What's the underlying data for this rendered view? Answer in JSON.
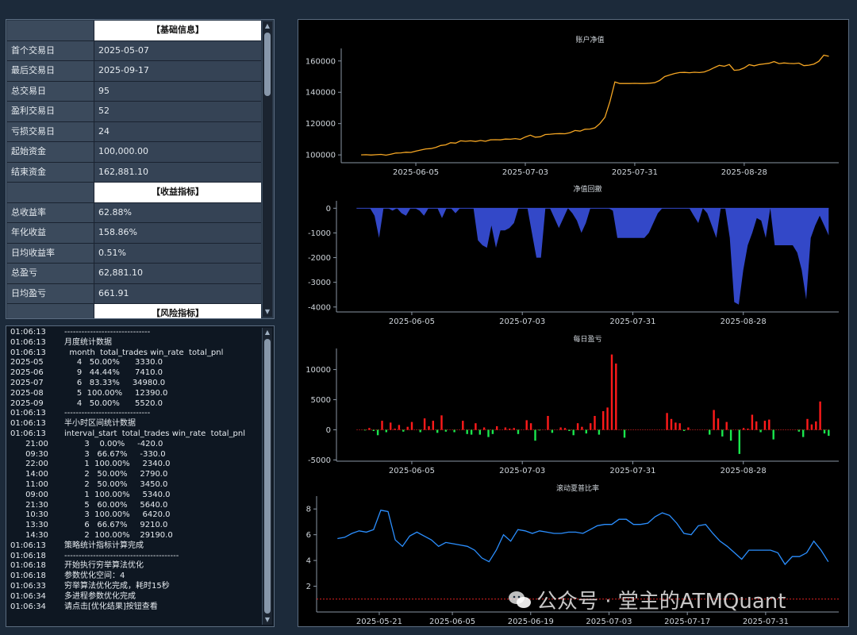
{
  "stats": {
    "rows": [
      {
        "k": "",
        "v": "【基础信息】",
        "section": true
      },
      {
        "k": "首个交易日",
        "v": "2025-05-07"
      },
      {
        "k": "最后交易日",
        "v": "2025-09-17"
      },
      {
        "k": "总交易日",
        "v": "95"
      },
      {
        "k": "盈利交易日",
        "v": "52"
      },
      {
        "k": "亏损交易日",
        "v": "24"
      },
      {
        "k": "起始资金",
        "v": "100,000.00"
      },
      {
        "k": "结束资金",
        "v": "162,881.10"
      },
      {
        "k": "",
        "v": "【收益指标】",
        "section": true
      },
      {
        "k": "总收益率",
        "v": "62.88%"
      },
      {
        "k": "年化收益",
        "v": "158.86%"
      },
      {
        "k": "日均收益率",
        "v": "0.51%"
      },
      {
        "k": "总盈亏",
        "v": "62,881.10"
      },
      {
        "k": "日均盈亏",
        "v": "661.91"
      },
      {
        "k": "",
        "v": "【风险指标】",
        "section": true
      }
    ]
  },
  "log": {
    "lines": [
      {
        "t": "01:06:13",
        "m": "------------------------------"
      },
      {
        "t": "01:06:13",
        "m": "月度统计数据"
      },
      {
        "t": "01:06:13",
        "m": "  month  total_trades win_rate  total_pnl"
      },
      {
        "t": "2025-05",
        "m": "     4   50.00%      3330.0"
      },
      {
        "t": "2025-06",
        "m": "     9   44.44%      7410.0"
      },
      {
        "t": "2025-07",
        "m": "     6   83.33%     34980.0"
      },
      {
        "t": "2025-08",
        "m": "     5  100.00%     12390.0"
      },
      {
        "t": "2025-09",
        "m": "     4   50.00%      5520.0"
      },
      {
        "t": "01:06:13",
        "m": "------------------------------"
      },
      {
        "t": "01:06:13",
        "m": "半小时区间统计数据"
      },
      {
        "t": "01:06:13",
        "m": "interval_start  total_trades win_rate  total_pnl"
      },
      {
        "t": "      21:00",
        "m": "        3    0.00%     -420.0"
      },
      {
        "t": "      09:30",
        "m": "        3   66.67%     -330.0"
      },
      {
        "t": "      22:00",
        "m": "        1  100.00%     2340.0"
      },
      {
        "t": "      14:00",
        "m": "        2   50.00%     2790.0"
      },
      {
        "t": "      11:00",
        "m": "        2   50.00%     3450.0"
      },
      {
        "t": "      09:00",
        "m": "        1  100.00%     5340.0"
      },
      {
        "t": "      21:30",
        "m": "        5   60.00%     5640.0"
      },
      {
        "t": "      10:30",
        "m": "        3  100.00%     6420.0"
      },
      {
        "t": "      13:30",
        "m": "        6   66.67%     9210.0"
      },
      {
        "t": "      14:30",
        "m": "        2  100.00%    29190.0"
      },
      {
        "t": "01:06:13",
        "m": "策略统计指标计算完成"
      },
      {
        "t": "01:06:18",
        "m": "----------------------------------------"
      },
      {
        "t": "01:06:18",
        "m": "开始执行穷举算法优化"
      },
      {
        "t": "01:06:18",
        "m": "参数优化空间：4"
      },
      {
        "t": "01:06:33",
        "m": "穷举算法优化完成，耗时15秒"
      },
      {
        "t": "01:06:34",
        "m": "多进程参数优化完成"
      },
      {
        "t": "01:06:34",
        "m": "请点击[优化结果]按钮查看"
      }
    ]
  },
  "watermark": {
    "text": "公众号 · 堂主的ATMQuant",
    "icon": "wechat-icon"
  },
  "colors": {
    "equity": "#f5a623",
    "drawdown": "#3348c8",
    "profit": "#ff1a1a",
    "loss": "#19e64d",
    "sharpe": "#2b8fff"
  },
  "chart_data": [
    {
      "type": "line",
      "title": "账户净值",
      "xticks": [
        "2025-06-05",
        "2025-07-03",
        "2025-07-31",
        "2025-08-28"
      ],
      "yticks": [
        100000,
        120000,
        140000,
        160000
      ],
      "ylim": [
        95000,
        168000
      ],
      "series": [
        {
          "values": [
            100000,
            100100,
            99900,
            100100,
            100300,
            99800,
            100500,
            101200,
            101300,
            101700,
            101600,
            102400,
            103100,
            103800,
            104000,
            104800,
            106000,
            106400,
            107800,
            107500,
            109000,
            108700,
            109000,
            108600,
            109200,
            108700,
            109600,
            109700,
            109600,
            110100,
            110000,
            110400,
            109900,
            111400,
            112600,
            111300,
            111600,
            113000,
            113200,
            113500,
            113600,
            113500,
            114200,
            115600,
            115200,
            116400,
            116500,
            117300,
            120000,
            124000,
            134000,
            146600,
            145600,
            145600,
            145600,
            145700,
            145600,
            145600,
            145800,
            146100,
            147500,
            150000,
            151000,
            152000,
            152600,
            152700,
            152500,
            152800,
            152600,
            153000,
            154200,
            155800,
            157200,
            156600,
            157700,
            154000,
            154300,
            155600,
            157600,
            156900,
            157700,
            158100,
            158500,
            159600,
            158300,
            158700,
            158400,
            158300,
            158600,
            157000,
            157300,
            158000,
            159800,
            163700,
            163000
          ]
        }
      ]
    },
    {
      "type": "area",
      "title": "净值回撤",
      "xticks": [
        "2025-06-05",
        "2025-07-03",
        "2025-07-31",
        "2025-08-28"
      ],
      "yticks": [
        0,
        -1000,
        -2000,
        -3000,
        -4000
      ],
      "ylim": [
        -4200,
        300
      ],
      "series": [
        {
          "values": [
            0,
            0,
            0,
            0,
            -300,
            -1200,
            0,
            0,
            -100,
            0,
            -200,
            -300,
            0,
            0,
            -100,
            -300,
            0,
            0,
            0,
            -400,
            0,
            0,
            -200,
            0,
            0,
            0,
            0,
            -1300,
            -1500,
            -1600,
            -700,
            -1600,
            -900,
            -900,
            -800,
            -600,
            0,
            0,
            0,
            -1000,
            -2000,
            -2000,
            0,
            0,
            -400,
            -800,
            -400,
            0,
            -200,
            -500,
            -1000,
            -600,
            0,
            0,
            0,
            0,
            0,
            -100,
            -1200,
            -1200,
            -1200,
            -1200,
            -1200,
            -1200,
            -1200,
            -1000,
            -600,
            -200,
            0,
            0,
            0,
            0,
            0,
            0,
            0,
            -300,
            -600,
            0,
            -200,
            -700,
            -1200,
            0,
            0,
            -1200,
            -3800,
            -3900,
            -2500,
            -1500,
            -1000,
            -400,
            -500,
            -1200,
            0,
            -1500,
            -1500,
            -1500,
            -1500,
            -1500,
            -1800,
            -2500,
            -3700,
            -1200,
            -700,
            -300,
            -700,
            -1100
          ]
        }
      ]
    },
    {
      "type": "bar",
      "title": "每日盈亏",
      "xticks": [
        "2025-06-05",
        "2025-07-03",
        "2025-07-31",
        "2025-08-28"
      ],
      "yticks": [
        10000,
        5000,
        0,
        -5000
      ],
      "ylim": [
        -5200,
        13500
      ],
      "series": [
        {
          "values": [
            0,
            0,
            -100,
            300,
            -200,
            -900,
            1500,
            -400,
            1200,
            200,
            800,
            -300,
            500,
            1300,
            0,
            -400,
            1900,
            600,
            1500,
            -500,
            2400,
            -300,
            0,
            -400,
            0,
            1500,
            -700,
            -800,
            1100,
            -800,
            400,
            -1200,
            -700,
            600,
            0,
            400,
            200,
            300,
            -700,
            0,
            1600,
            1100,
            -1800,
            -100,
            0,
            2300,
            -500,
            0,
            400,
            300,
            -200,
            -900,
            1100,
            500,
            -600,
            1100,
            2300,
            -800,
            3100,
            3700,
            12500,
            11000,
            0,
            -1300,
            0,
            0,
            0,
            0,
            0,
            0,
            0,
            0,
            0,
            2800,
            1800,
            1200,
            1100,
            -200,
            400,
            0,
            0,
            0,
            0,
            -800,
            3300,
            1900,
            -1100,
            1300,
            -1800,
            0,
            -4000,
            300,
            200,
            2500,
            1400,
            -400,
            1500,
            1700,
            -1600,
            0,
            0,
            0,
            0,
            0,
            -300,
            -1200,
            1800,
            900,
            1400,
            4700,
            -600,
            -1000
          ]
        }
      ]
    },
    {
      "type": "line",
      "title": "滚动夏普比率",
      "xticks": [
        "2025-05-21",
        "2025-06-05",
        "2025-06-19",
        "2025-07-03",
        "2025-07-17",
        "2025-07-31"
      ],
      "yticks": [
        2,
        4,
        6,
        8
      ],
      "ylim": [
        0,
        9
      ],
      "series": [
        {
          "values": [
            5.7,
            5.8,
            6.1,
            6.3,
            6.2,
            6.4,
            7.9,
            7.8,
            5.6,
            5.1,
            5.9,
            6.2,
            5.9,
            5.6,
            5.1,
            5.4,
            5.3,
            5.2,
            5.1,
            4.8,
            4.2,
            3.9,
            4.8,
            6.0,
            5.5,
            6.4,
            6.3,
            6.1,
            6.3,
            6.2,
            6.1,
            6.1,
            6.2,
            6.2,
            6.1,
            6.4,
            6.7,
            6.8,
            6.8,
            7.2,
            7.2,
            6.8,
            6.8,
            6.9,
            7.4,
            7.7,
            7.5,
            6.9,
            6.1,
            6.0,
            6.7,
            6.8,
            6.1,
            5.5,
            5.1,
            4.6,
            4.1,
            4.8,
            4.8,
            4.8,
            4.8,
            4.6,
            3.7,
            4.3,
            4.3,
            4.6,
            5.5,
            4.8,
            3.9
          ]
        }
      ],
      "hline": 1
    }
  ]
}
